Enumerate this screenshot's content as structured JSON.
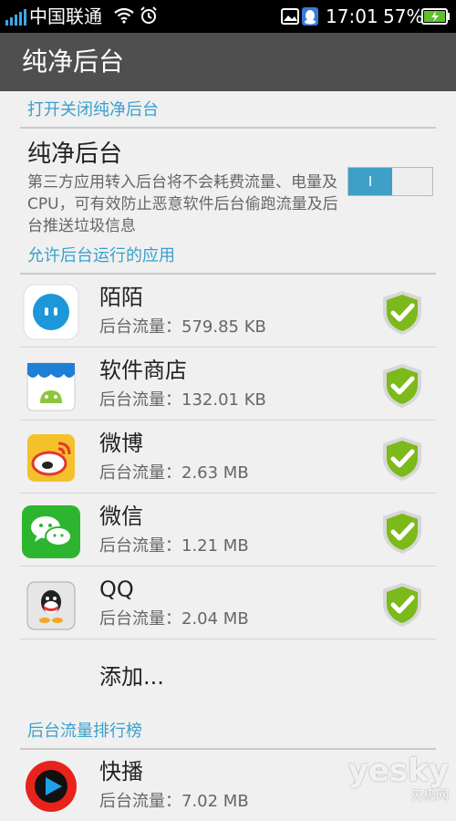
{
  "status_bar": {
    "carrier": "中国联通",
    "time": "17:01",
    "battery": "57%"
  },
  "title_bar": {
    "title": "纯净后台"
  },
  "sections": {
    "toggle_header": "打开关闭纯净后台",
    "allowed_header": "允许后台运行的应用",
    "ranking_header": "后台流量排行榜"
  },
  "pure_background": {
    "title": "纯净后台",
    "description": "第三方应用转入后台将不会耗费流量、电量及CPU，可有效防止恶意软件后台偷跑流量及后台推送垃圾信息",
    "toggle_label": "I",
    "enabled": true
  },
  "allowed_apps": [
    {
      "name": "陌陌",
      "traffic": "后台流量：579.85 KB",
      "icon": "momo-icon"
    },
    {
      "name": "软件商店",
      "traffic": "后台流量：132.01 KB",
      "icon": "app-store-icon"
    },
    {
      "name": "微博",
      "traffic": "后台流量：2.63 MB",
      "icon": "weibo-icon"
    },
    {
      "name": "微信",
      "traffic": "后台流量：1.21 MB",
      "icon": "wechat-icon"
    },
    {
      "name": "QQ",
      "traffic": "后台流量：2.04 MB",
      "icon": "qq-icon"
    }
  ],
  "add_label": "添加...",
  "ranking_apps": [
    {
      "name": "快播",
      "traffic": "后台流量：7.02 MB",
      "icon": "qvod-icon"
    }
  ],
  "watermark": {
    "brand": "yesky",
    "sub": "天极网"
  },
  "colors": {
    "accent": "#3aa0cc",
    "titlebar": "#4f4f4f",
    "shield_green": "#7cb91a"
  }
}
